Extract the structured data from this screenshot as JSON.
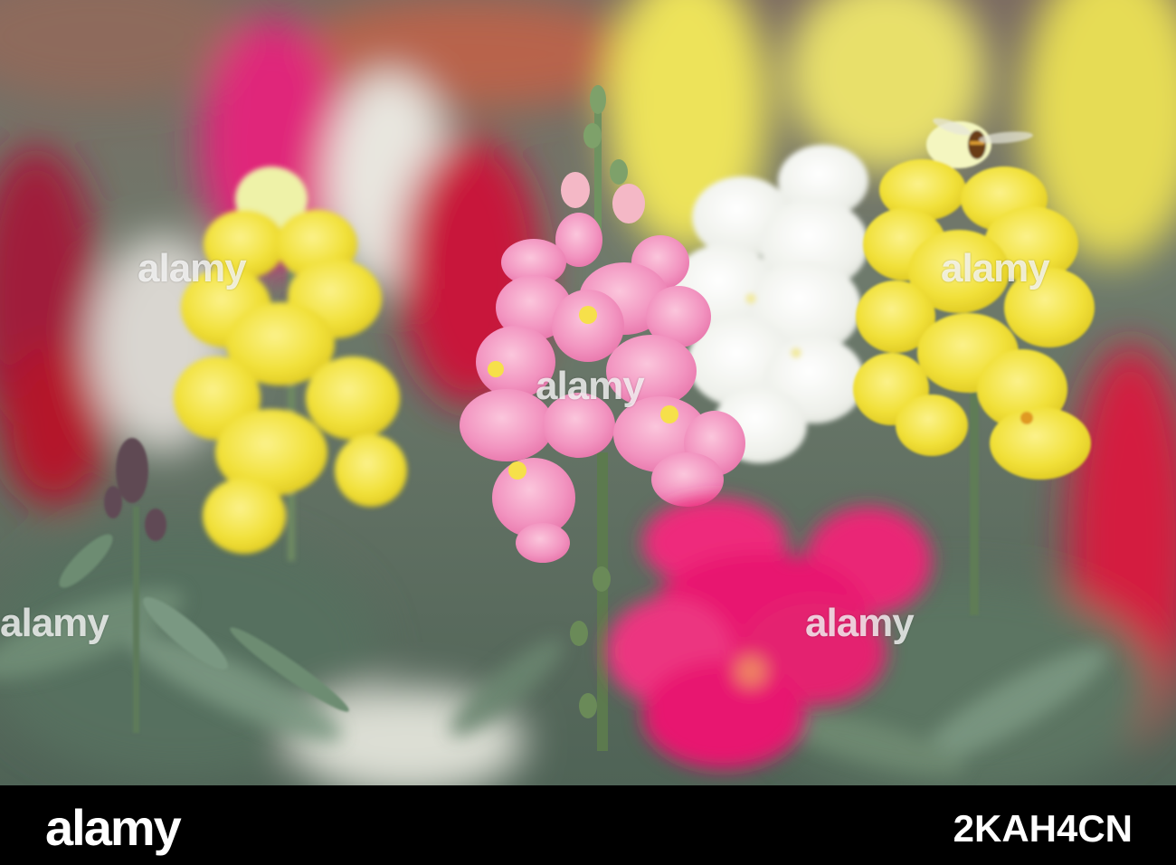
{
  "photo": {
    "subject": "snapdragon-flowers",
    "palette": {
      "background_green": "#5a6b60",
      "pink": "#f08cbf",
      "magenta": "#e8196f",
      "yellow": "#f2e23a",
      "white": "#f4f4f0",
      "red": "#c8102e",
      "leaf": "#6f8a72"
    }
  },
  "watermark": {
    "text": "alamy"
  },
  "footer": {
    "logo_text": "alamy",
    "image_id": "2KAH4CN"
  }
}
